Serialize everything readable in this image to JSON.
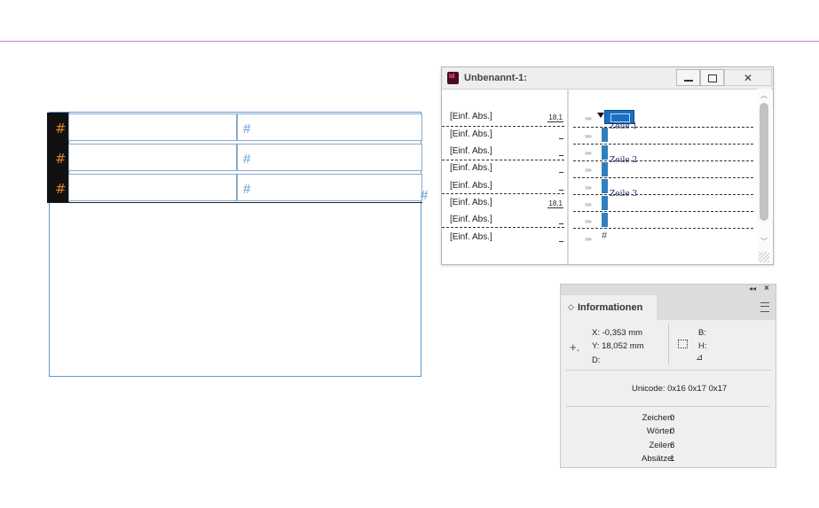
{
  "canvas": {
    "cell_marker": "#",
    "table_rows": [
      {
        "lead": "#",
        "cell1": "",
        "cell2": "#"
      },
      {
        "lead": "#",
        "cell1": "",
        "cell2": "#"
      },
      {
        "lead": "#",
        "cell1": "",
        "cell2": "#"
      }
    ],
    "overset": "#"
  },
  "story_editor": {
    "title": "Unbenannt-1:",
    "paragraphs": [
      {
        "style": "[Einf. Abs.]",
        "depth": "18,1"
      },
      {
        "style": "[Einf. Abs.]",
        "depth": ""
      },
      {
        "style": "[Einf. Abs.]",
        "depth": ""
      },
      {
        "style": "[Einf. Abs.]",
        "depth": ""
      },
      {
        "style": "[Einf. Abs.]",
        "depth": ""
      },
      {
        "style": "[Einf. Abs.]",
        "depth": "18,1"
      },
      {
        "style": "[Einf. Abs.]",
        "depth": ""
      },
      {
        "style": "[Einf. Abs.]",
        "depth": ""
      }
    ],
    "row_labels": [
      "Zeile 1",
      "Zeile 2",
      "Zeile 3"
    ],
    "row_marker": "»»",
    "end_marker": "#",
    "icons": {
      "app": "indesign-icon",
      "minimize": "minimize-icon",
      "maximize": "maximize-icon",
      "close": "close-icon"
    }
  },
  "info_panel": {
    "title": "Informationen",
    "x": "X: -0,353 mm",
    "y": "Y: 18,052 mm",
    "d": "D:",
    "b": "B:",
    "h": "H:",
    "unicode": "Unicode: 0x16 0x17 0x17",
    "counts": [
      {
        "label": "Zeichen:",
        "value": "0"
      },
      {
        "label": "Wörter:",
        "value": "0"
      },
      {
        "label": "Zeilen:",
        "value": "6"
      },
      {
        "label": "Absätze:",
        "value": "1"
      }
    ]
  }
}
